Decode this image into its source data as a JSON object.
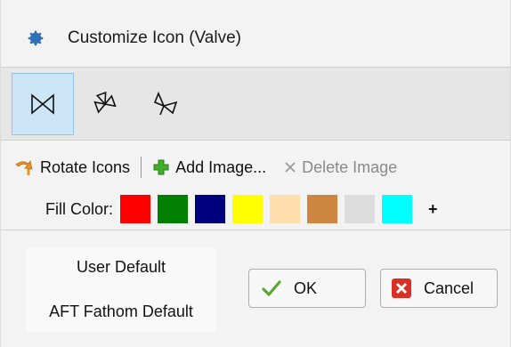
{
  "window": {
    "title": "Customize Icon (Valve)",
    "icon": "gear-icon"
  },
  "icon_styles": [
    {
      "name": "bowtie-valve-icon",
      "selected": true
    },
    {
      "name": "angle-valve-up-icon",
      "selected": false
    },
    {
      "name": "angle-valve-down-icon",
      "selected": false
    }
  ],
  "actions": {
    "rotate": {
      "label": "Rotate Icons",
      "icon": "rotate-icon"
    },
    "add_image": {
      "label": "Add Image...",
      "icon": "green-plus-icon"
    },
    "delete_image": {
      "label": "Delete Image",
      "icon": "x-icon",
      "disabled": true
    }
  },
  "fill": {
    "label": "Fill Color:",
    "colors": [
      "#ff0000",
      "#007f00",
      "#00007f",
      "#ffff00",
      "#ffdead",
      "#cd853f",
      "#dcdcdc",
      "#00ffff"
    ],
    "more_label": "+"
  },
  "defaults": {
    "user_default": "User Default",
    "aft_default": "AFT Fathom Default"
  },
  "buttons": {
    "ok": "OK",
    "cancel": "Cancel"
  },
  "colors": {
    "accent_selected": "#cde6f7",
    "ok_check": "#5aa832",
    "cancel_red": "#d93025"
  }
}
